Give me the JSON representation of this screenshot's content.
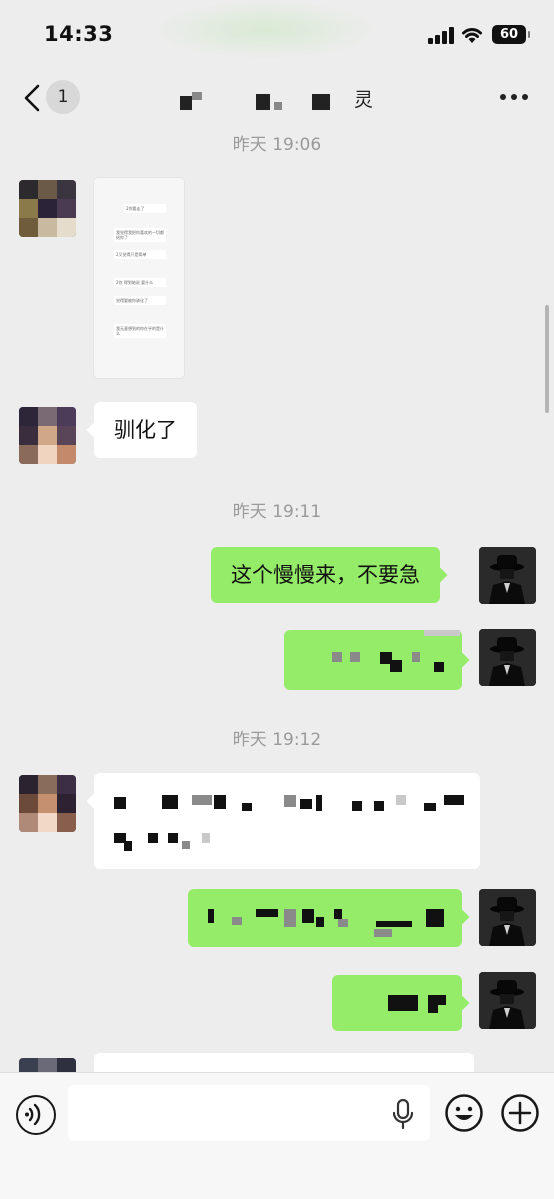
{
  "status_bar": {
    "time": "14:33",
    "battery": "60"
  },
  "nav": {
    "unread_count": "1",
    "title_glyph": "灵"
  },
  "messages": {
    "ts1": "昨天 19:06",
    "msg_white_1": "驯化了",
    "ts2": "昨天 19:11",
    "msg_green_1": "这个慢慢来，不要急",
    "ts3": "昨天 19:12"
  },
  "screenshot_card": {
    "lines": [
      "2你要走了",
      "我觉得我把你喜欢的一切都给你了",
      "2又觉得只是简单",
      "2你 得到她说 要什么",
      "觉得要被你驯化了",
      "我无意想到的你在乎的是什么"
    ]
  },
  "icons": {
    "back": "chevron-left-icon",
    "more": "more-dots-icon",
    "voice": "voice-icon",
    "mic": "mic-icon",
    "emoji": "emoji-icon",
    "plus": "plus-icon"
  }
}
